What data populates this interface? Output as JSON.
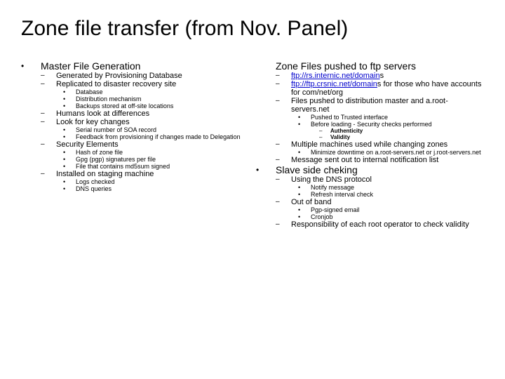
{
  "title": "Zone file transfer (from Nov. Panel)",
  "left": {
    "h1": "Master File Generation",
    "i1": "Generated by Provisioning Database",
    "i2": "Replicated to disaster recovery site",
    "i2a": "Database",
    "i2b": "Distribution mechanism",
    "i2c": "Backups stored at off-site locations",
    "i3": "Humans look at differences",
    "i4": "Look for key changes",
    "i4a": "Serial number of SOA record",
    "i4b": "Feedback from provisioning if changes made to Delegation",
    "i5": "Security Elements",
    "i5a": "Hash of zone file",
    "i5b": "Gpg (pgp) signatures per file",
    "i5c": "File that contains md5sum signed",
    "i6": "Installed on staging machine",
    "i6a": "Logs checked",
    "i6b": "DNS queries"
  },
  "right": {
    "h1": "Zone Files pushed to ftp servers",
    "link1": "ftp://rs.internic.net/domain",
    "link1tail": "s",
    "link2pre": " ",
    "link2": "ftp://ftp.crsnic.net/domain",
    "link2tail": "s for those who have accounts for com/net/org",
    "i3": "Files pushed to distribution master and a.root-servers.net",
    "i3a": "Pushed to Trusted interface",
    "i3b": "Before loading - Security checks performed",
    "i3b1": "Authenticity",
    "i3b2": "Validity",
    "i4": "Multiple machines used while changing zones",
    "i4a": "Minimize downtime on a.root-servers.net or j.root-servers.net",
    "i5": "Message sent out to internal notification list",
    "h2": "Slave side cheking",
    "j1": "Using the DNS protocol",
    "j1a": "Notify message",
    "j1b": "Refresh interval check",
    "j2": "Out of band",
    "j2a": "Pgp-signed email",
    "j2b": "Cronjob",
    "j3": "Responsibility of each root operator to check validity"
  }
}
